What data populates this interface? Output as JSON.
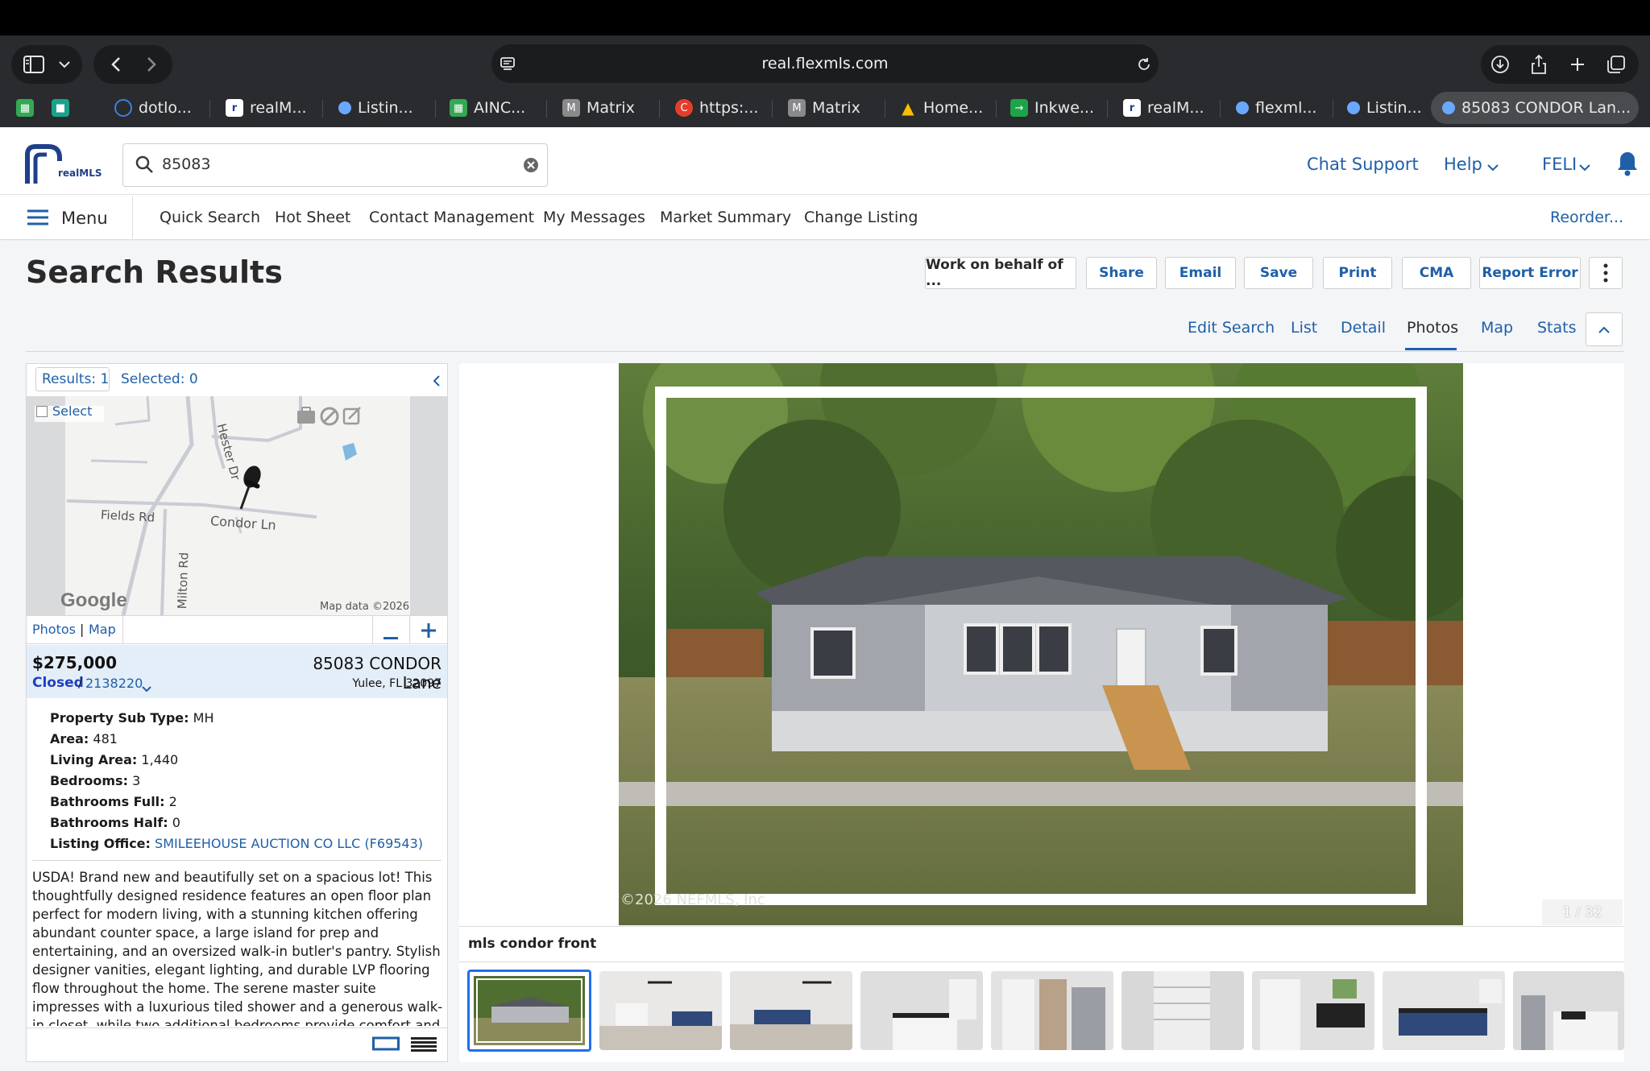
{
  "browser": {
    "url": "real.flexmls.com",
    "tabs": [
      {
        "label": "dotlo...",
        "icon": "dotloop-icon",
        "color": "#3d7fe0"
      },
      {
        "label": "realM...",
        "icon": "realmls-icon",
        "color": "#ffffff"
      },
      {
        "label": "Listin...",
        "icon": "listing-icon",
        "color": "#6aa8ff"
      },
      {
        "label": "AINC...",
        "icon": "sheets-icon",
        "color": "#34a853"
      },
      {
        "label": "Matrix",
        "icon": "matrix-icon",
        "color": "#8a8a8a"
      },
      {
        "label": "https:...",
        "icon": "c-icon",
        "color": "#e53e2c"
      },
      {
        "label": "Matrix",
        "icon": "matrix-icon",
        "color": "#8a8a8a"
      },
      {
        "label": "Home...",
        "icon": "drive-icon",
        "color": "#fbbc04"
      },
      {
        "label": "Inkwe...",
        "icon": "inkwell-icon",
        "color": "#1fa34a"
      },
      {
        "label": "realM...",
        "icon": "realmls-icon",
        "color": "#ffffff"
      },
      {
        "label": "flexml...",
        "icon": "flexmls-icon",
        "color": "#6aa8ff"
      },
      {
        "label": "Listin...",
        "icon": "listing-icon",
        "color": "#6aa8ff"
      },
      {
        "label": "85083 CONDOR Lan...",
        "icon": "flexmls-icon",
        "color": "#6aa8ff"
      }
    ]
  },
  "header": {
    "logo_text": "realMLS",
    "search_value": "85083",
    "chat_support": "Chat Support",
    "help": "Help",
    "user": "FELI"
  },
  "menu": {
    "label": "Menu",
    "items": [
      "Quick Search",
      "Hot Sheet",
      "Contact Management",
      "My Messages",
      "Market Summary",
      "Change Listing"
    ],
    "reorder": "Reorder..."
  },
  "page": {
    "title": "Search Results",
    "buttons": [
      "Work on behalf of ...",
      "Share",
      "Email",
      "Save",
      "Print",
      "CMA",
      "Report Error"
    ],
    "view_tabs": [
      "Edit Search",
      "List",
      "Detail",
      "Photos",
      "Map",
      "Stats"
    ],
    "active_view": "Photos"
  },
  "results": {
    "count_label": "Results: 1",
    "selected_label": "Selected: 0",
    "select_label": "Select",
    "map_labels": {
      "street1": "Hester Dr",
      "street2": "Condor Ln",
      "street3": "Fields Rd",
      "street4": "Milton Rd",
      "google": "Google",
      "map_data": "Map data ©2026"
    },
    "photos_link": "Photos",
    "map_link": "Map",
    "separator": "|"
  },
  "listing": {
    "price": "$275,000",
    "status": "Closed",
    "mls_number": "2138220",
    "address": "85083 CONDOR Lane",
    "city_state_zip": "Yulee, FL 32097",
    "fields": [
      {
        "label": "Property Sub Type:",
        "value": "MH"
      },
      {
        "label": "Area:",
        "value": "481"
      },
      {
        "label": "Living Area:",
        "value": "1,440"
      },
      {
        "label": "Bedrooms:",
        "value": "3"
      },
      {
        "label": "Bathrooms Full:",
        "value": "2"
      },
      {
        "label": "Bathrooms Half:",
        "value": "0"
      },
      {
        "label": "Listing Office:",
        "value": "SMILEEHOUSE AUCTION CO LLC (F69543)"
      }
    ],
    "description": "USDA! Brand new and beautifully set on a spacious lot! This thoughtfully designed residence features an open floor plan perfect for modern living, with a stunning kitchen offering abundant counter space, a large island for prep and entertaining, and an oversized walk-in butler's pantry. Stylish designer vanities, elegant lighting, and durable LVP flooring flow throughout the home. The serene master suite impresses with a luxurious tiled shower and a generous walk-in closet, while two additional bedrooms provide comfort and flexibility. Enjoy peace of mind with"
  },
  "photo": {
    "watermark": "©2026 NEFMLS, Inc",
    "counter": "1 / 32",
    "caption": "mls condor front",
    "thumbnails": [
      "exterior-front",
      "living-room",
      "living-room-fan",
      "kitchen",
      "hallway-fridge",
      "pantry-shelves",
      "bathroom",
      "kitchen-island",
      "kitchen-range"
    ]
  }
}
